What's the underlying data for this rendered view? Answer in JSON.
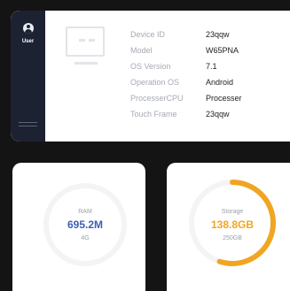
{
  "sidebar": {
    "user_label": "User",
    "icon": "user-icon"
  },
  "device_info": {
    "rows": [
      {
        "label": "Device ID",
        "value": "23qqw"
      },
      {
        "label": "Model",
        "value": "W65PNA"
      },
      {
        "label": "OS Version",
        "value": "7.1"
      },
      {
        "label": "Operation OS",
        "value": "Android"
      },
      {
        "label": "ProcesserCPU",
        "value": "Processer"
      },
      {
        "label": "Touch Frame",
        "value": "23qqw"
      }
    ]
  },
  "ram": {
    "label": "RAM",
    "value": "695.2M",
    "total": "4G",
    "usage_fraction": 0.0,
    "accent": "#3e5fb3"
  },
  "storage": {
    "label": "Storage",
    "value": "138.8GB",
    "total": "250GB",
    "usage_fraction": 0.55,
    "accent": "#f0a623"
  },
  "colors": {
    "background": "#141414",
    "sidebar": "#1c2232",
    "track": "#f4f4f4"
  }
}
